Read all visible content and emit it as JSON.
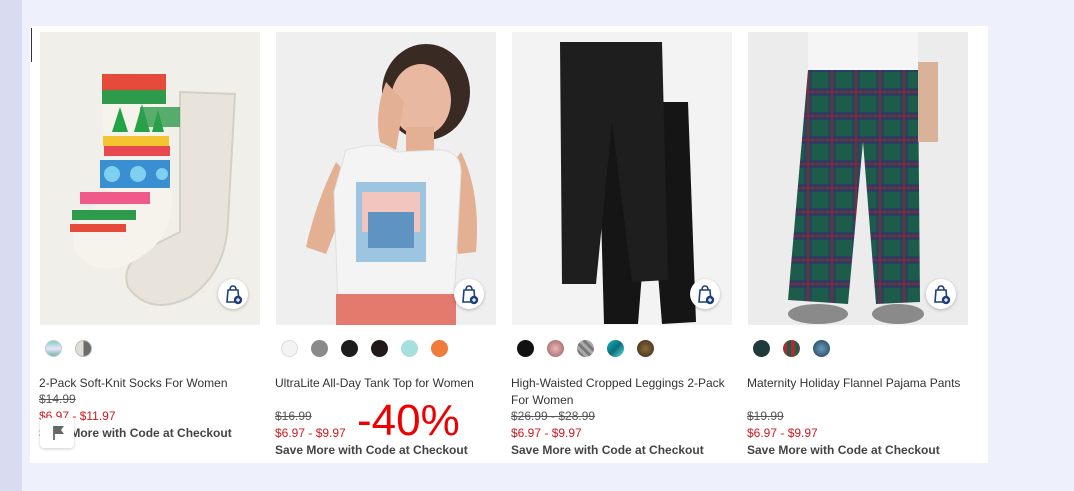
{
  "products": [
    {
      "name": "2-Pack Soft-Knit Socks For Women",
      "original_price": "$14.99",
      "sale_price": "$6.97 - $11.97",
      "promo": "Save More with Code at Checkout"
    },
    {
      "name": "UltraLite All-Day Tank Top for Women",
      "original_price": "$16.99",
      "sale_price": "$6.97 - $9.97",
      "promo": "Save More with Code at Checkout"
    },
    {
      "name": "High-Waisted Cropped Leggings 2-Pack For Women",
      "original_price": "$26.99 - $28.99",
      "sale_price": "$6.97 - $9.97",
      "promo": "Save More with Code at Checkout"
    },
    {
      "name": "Maternity Holiday Flannel Pajama Pants",
      "original_price": "$19.99",
      "sale_price": "$6.97 - $9.97",
      "promo": "Save More with Code at Checkout"
    }
  ],
  "discount_badge": "-40%",
  "colors": {
    "sale": "#d0181e",
    "badge": "#ee0000",
    "bag_icon": "#1f3f7a"
  },
  "icons": [
    "shopping-bag-icon",
    "flag-icon"
  ]
}
